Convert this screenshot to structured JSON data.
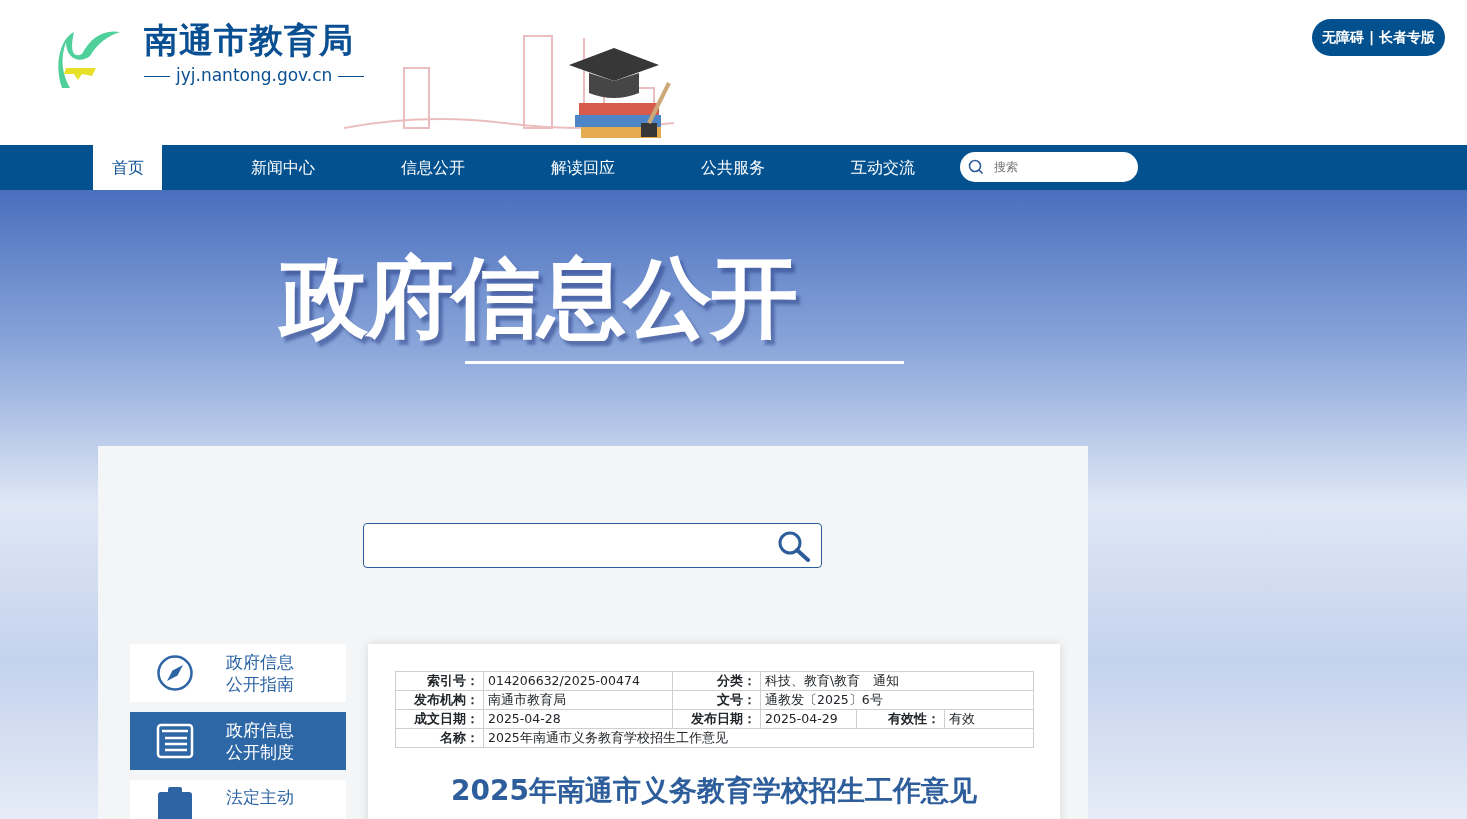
{
  "header": {
    "site_title": "南通市教育局",
    "site_domain": "jyj.nantong.gov.cn",
    "accessibility_button": "无障碍 | 长者专版"
  },
  "nav": {
    "items": [
      {
        "label": "首页",
        "selected": true
      },
      {
        "label": "新闻中心",
        "selected": false
      },
      {
        "label": "信息公开",
        "selected": false
      },
      {
        "label": "解读回应",
        "selected": false
      },
      {
        "label": "公共服务",
        "selected": false
      },
      {
        "label": "互动交流",
        "selected": false
      }
    ],
    "search": {
      "placeholder": "搜索"
    }
  },
  "banner": {
    "title": "政府信息公开"
  },
  "sidebar": {
    "items": [
      {
        "lines": [
          "政府信息",
          "公开指南"
        ],
        "selected": false
      },
      {
        "lines": [
          "政府信息",
          "公开制度"
        ],
        "selected": true
      },
      {
        "lines": [
          "法定主动"
        ],
        "selected": false
      }
    ]
  },
  "metadata": {
    "rows": [
      [
        {
          "label": "索引号：",
          "value": "014206632/2025-00474"
        },
        {
          "label": "分类：",
          "value": "科技、教育\\教育　通知"
        }
      ],
      [
        {
          "label": "发布机构：",
          "value": "南通市教育局"
        },
        {
          "label": "文号：",
          "value": "通教发〔2025〕6号"
        }
      ],
      [
        {
          "label": "成文日期：",
          "value": "2025-04-28"
        },
        {
          "label": "发布日期：",
          "value": "2025-04-29"
        },
        {
          "label": "有效性：",
          "value": "有效"
        }
      ],
      [
        {
          "label": "名称：",
          "value": "2025年南通市义务教育学校招生工作意见"
        }
      ]
    ]
  },
  "article": {
    "title": "2025年南通市义务教育学校招生工作意见"
  }
}
